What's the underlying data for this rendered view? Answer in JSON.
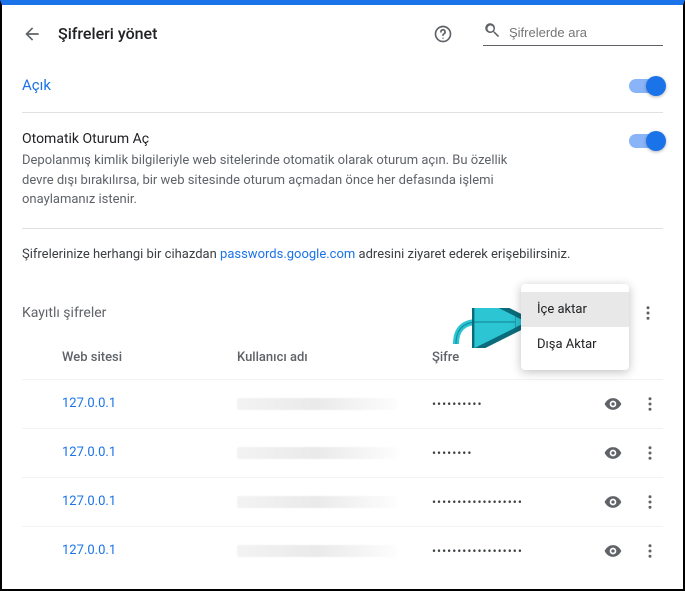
{
  "header": {
    "title": "Şifreleri yönet",
    "search_placeholder": "Şifrelerde ara"
  },
  "toggles": {
    "on_label": "Açık",
    "auto_signin_title": "Otomatik Oturum Aç",
    "auto_signin_desc": "Depolanmış kimlik bilgileriyle web sitelerinde otomatik olarak oturum açın. Bu özellik devre dışı bırakılırsa, bir web sitesinde oturum açmadan önce her defasında işlemi onaylamanız istenir."
  },
  "info_prefix": "Şifrelerinize herhangi bir cihazdan ",
  "info_link": "passwords.google.com",
  "info_suffix": " adresini ziyaret ederek erişebilirsiniz.",
  "saved": {
    "title": "Kayıtlı şifreler",
    "col_site": "Web sitesi",
    "col_user": "Kullanıcı adı",
    "col_pass": "Şifre",
    "rows": [
      {
        "site": "127.0.0.1",
        "password_mask": "••••••••••"
      },
      {
        "site": "127.0.0.1",
        "password_mask": "••••••••"
      },
      {
        "site": "127.0.0.1",
        "password_mask": "••••••••••••••••••"
      },
      {
        "site": "127.0.0.1",
        "password_mask": "••••••••••••••••••"
      }
    ]
  },
  "menu": {
    "import": "İçe aktar",
    "export": "Dışa Aktar"
  }
}
